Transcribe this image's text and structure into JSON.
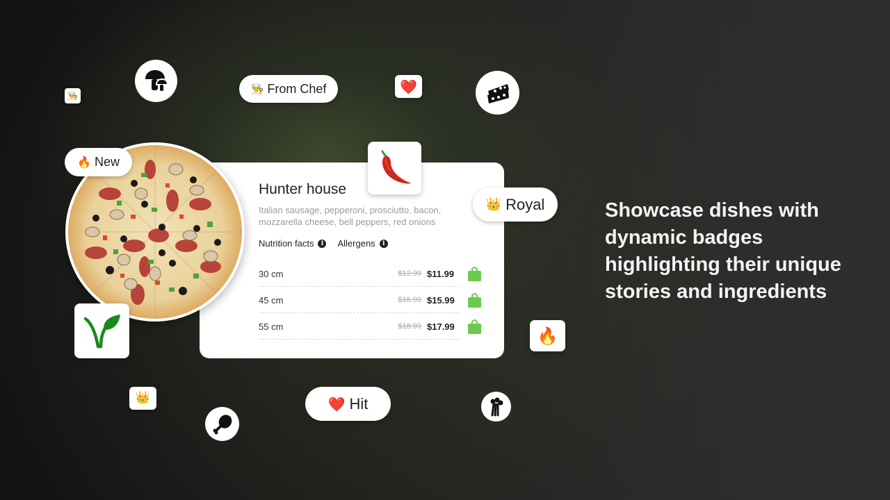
{
  "headline": "Showcase dishes with dynamic badges highlighting their unique stories and ingredients",
  "badges": {
    "from_chef": {
      "icon": "👨‍🍳",
      "label": "From Chef"
    },
    "new": {
      "icon": "🔥",
      "label": "New"
    },
    "royal": {
      "icon": "👑",
      "label": "Royal"
    },
    "hit": {
      "icon": "❤️",
      "label": "Hit"
    }
  },
  "icon_tiles": {
    "chef_small": "👨‍🍳",
    "heart": "❤️",
    "chili": "🌶️",
    "fire": "🔥",
    "crown_small": "👑",
    "vegan": "V"
  },
  "product": {
    "name": "Hunter house",
    "description": "Italian sausage, pepperoni, prosciutto, bacon, mozzarella cheese, bell peppers, red onions",
    "links": [
      {
        "label": "Nutrition facts",
        "icon": "i"
      },
      {
        "label": "Allergens",
        "icon": "i"
      }
    ],
    "sizes": [
      {
        "size": "30 cm",
        "old_price": "$12.99",
        "price": "$11.99"
      },
      {
        "size": "45 cm",
        "old_price": "$16.99",
        "price": "$15.99"
      },
      {
        "size": "55 cm",
        "old_price": "$18.99",
        "price": "$17.99"
      }
    ]
  },
  "colors": {
    "accent_green": "#6cc94f",
    "vegan_green": "#1a8a1a"
  }
}
